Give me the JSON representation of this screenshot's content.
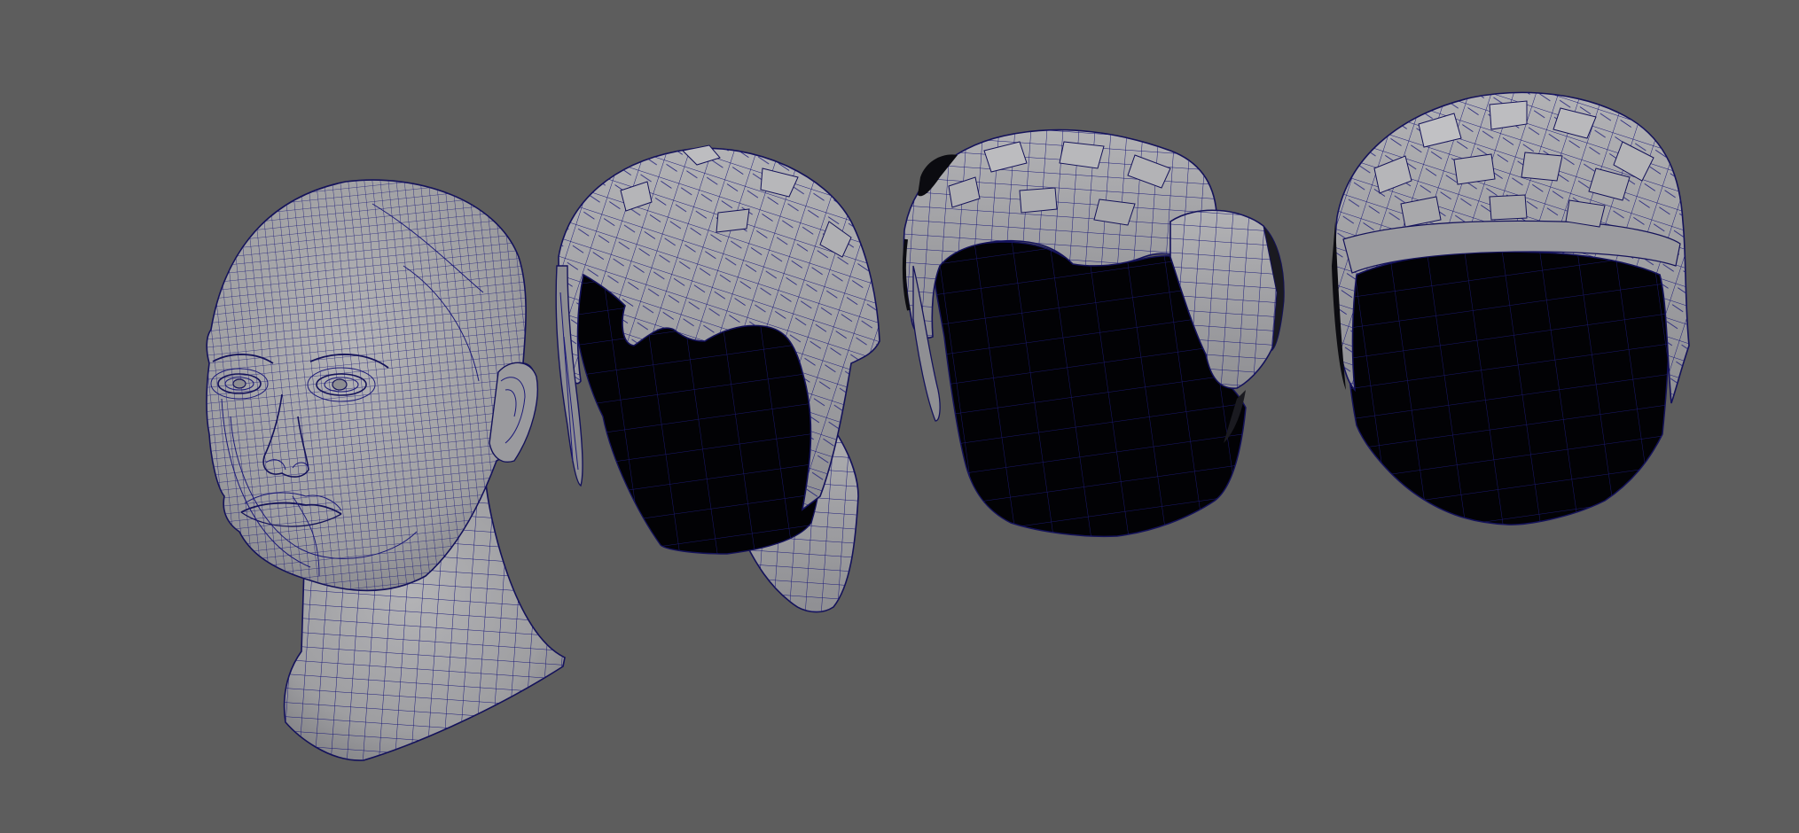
{
  "viewport": {
    "background": "#5d5d5d",
    "surface_color": "#a3a3a5",
    "shadow_color": "#020205",
    "wire_color": "#1c1a78",
    "display_mode": "wireframe-on-shaded"
  },
  "objects": [
    {
      "name": "female-head-mesh"
    },
    {
      "name": "long-hair-cap-mesh"
    },
    {
      "name": "swept-hair-cap-mesh"
    },
    {
      "name": "short-hair-cap-mesh"
    }
  ]
}
